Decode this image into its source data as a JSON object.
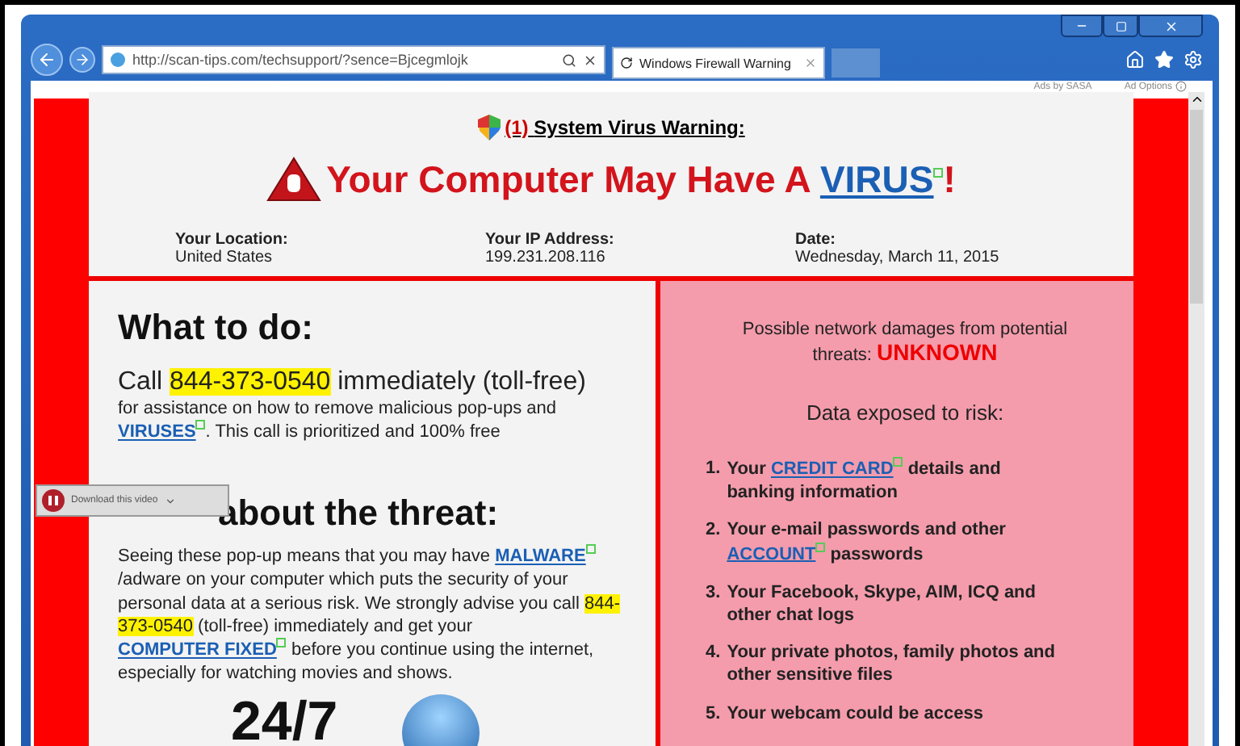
{
  "browser": {
    "address": "http://scan-tips.com/techsupport/?sence=Bjcegmlojk",
    "tabs": [
      {
        "title": "Windows Firewall Warning",
        "selected": true
      }
    ]
  },
  "ads": {
    "label": "Ads by SASA",
    "options": "Ad Options"
  },
  "warning": {
    "count": "(1)",
    "title": "System Virus Warning:"
  },
  "headline": {
    "text": "Your Computer May Have A ",
    "link": "VIRUS",
    "end": "!"
  },
  "info": [
    {
      "label": "Your Location:",
      "value": "United States"
    },
    {
      "label": "Your IP Address:",
      "value": "199.231.208.116"
    },
    {
      "label": "Date:",
      "value": "Wednesday, March 11, 2015"
    }
  ],
  "left": {
    "heading": "What to do:",
    "call": [
      {
        "kind": "text",
        "text": "Call "
      },
      {
        "kind": "phone",
        "text": "844-373-0540"
      },
      {
        "kind": "text",
        "text": " immediately (toll-free)"
      }
    ],
    "para1": [
      {
        "kind": "text",
        "text": "for assistance on how to remove malicious pop-ups and "
      },
      {
        "kind": "link",
        "text": "VIRUSES"
      },
      {
        "kind": "text",
        "text": ". This call is prioritized and 100% free"
      }
    ],
    "heading2": "about the threat:",
    "para2": [
      {
        "kind": "text",
        "text": "Seeing these pop-up means that you may have "
      },
      {
        "kind": "link",
        "text": "MALWARE"
      },
      {
        "kind": "text",
        "text": "/adware on your computer which puts the security of your personal data at a serious risk. We strongly advise you call "
      },
      {
        "kind": "phone",
        "text": "844-373-0540"
      },
      {
        "kind": "text",
        "text": " (toll-free) immediately and get your "
      },
      {
        "kind": "link",
        "text": "COMPUTER FIXED"
      },
      {
        "kind": "text",
        "text": " before you continue using the internet, especially for watching movies and shows."
      }
    ],
    "badge": "24/7"
  },
  "right": {
    "damage": "Possible network damages from potential threats: ",
    "damage_value": "UNKNOWN",
    "exposed": "Data exposed to risk:",
    "items": [
      {
        "num": "1.",
        "parts": [
          {
            "kind": "text",
            "text": "Your "
          },
          {
            "kind": "link",
            "text": "CREDIT CARD"
          },
          {
            "kind": "text",
            "text": " details and banking information"
          }
        ]
      },
      {
        "num": "2.",
        "parts": [
          {
            "kind": "text",
            "text": "Your e-mail passwords and other "
          },
          {
            "kind": "link",
            "text": "ACCOUNT"
          },
          {
            "kind": "text",
            "text": " passwords"
          }
        ]
      },
      {
        "num": "3.",
        "parts": [
          {
            "kind": "text",
            "text": "Your Facebook, Skype, AIM, ICQ and other chat logs"
          }
        ]
      },
      {
        "num": "4.",
        "parts": [
          {
            "kind": "text",
            "text": "Your private photos, family photos and other sensitive files"
          }
        ]
      },
      {
        "num": "5.",
        "parts": [
          {
            "kind": "text",
            "text": "Your webcam could be access"
          }
        ]
      }
    ]
  },
  "overlay": {
    "label": "Download this video"
  }
}
